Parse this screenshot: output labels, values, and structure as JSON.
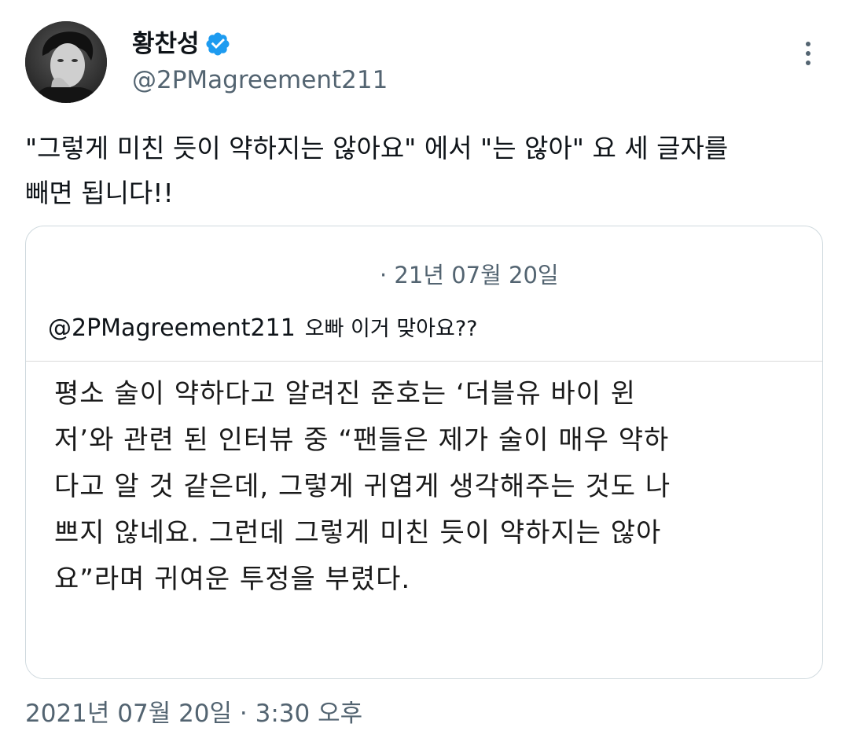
{
  "author": {
    "display_name": "황찬성",
    "handle": "@2PMagreement211",
    "verified": true,
    "avatar_icon": "user-avatar"
  },
  "tweet": {
    "text": "\"그렇게 미친 듯이 약하지는 않아요\" 에서 \"는 않아\" 요 세 글자를\n빼면 됩니다!!",
    "timestamp": "2021년 07월 20일 · 3:30 오후"
  },
  "quote": {
    "date": "· 21년 07월 20일",
    "mention": "@2PMagreement211",
    "reply_text": "오빠 이거 맞아요??",
    "image_text": "평소 술이 약하다고 알려진 준호는 ‘더블유 바이 윈\n저’와 관련 된 인터뷰 중 “팬들은 제가 술이 매우 약하\n다고 알 것 같은데, 그렇게 귀엽게 생각해주는 것도 나\n쁘지 않네요. 그런데 그렇게 미친 듯이 약하지는 않아\n요”라며 귀여운 투정을 부렸다."
  },
  "icons": {
    "verified": "verified-badge-icon",
    "more": "more-vertical-icon"
  },
  "colors": {
    "verified_blue": "#1d9bf0",
    "secondary_text": "#536471",
    "border": "#cfd9de"
  }
}
